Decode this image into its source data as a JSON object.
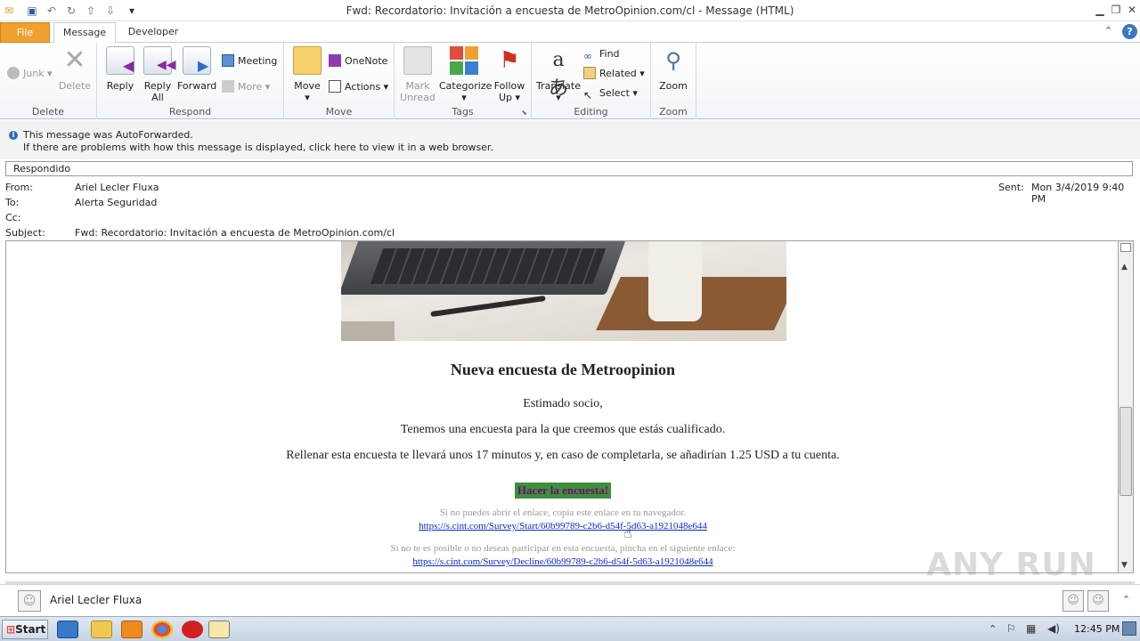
{
  "window": {
    "title": "Fwd: Recordatorio: Invitación a encuesta de MetroOpinion.com/cl - Message (HTML)"
  },
  "tabs": {
    "file": "File",
    "message": "Message",
    "developer": "Developer"
  },
  "ribbon": {
    "delete_group": {
      "label": "Delete",
      "junk": "Junk",
      "delete": "Delete"
    },
    "respond_group": {
      "label": "Respond",
      "reply": "Reply",
      "reply_all_1": "Reply",
      "reply_all_2": "All",
      "forward": "Forward",
      "meeting": "Meeting",
      "more": "More"
    },
    "move_group": {
      "label": "Move",
      "move": "Move",
      "onenote": "OneNote",
      "actions": "Actions"
    },
    "tags_group": {
      "label": "Tags",
      "mark_unread_1": "Mark",
      "mark_unread_2": "Unread",
      "categorize": "Categorize",
      "follow_up_1": "Follow",
      "follow_up_2": "Up"
    },
    "editing_group": {
      "label": "Editing",
      "translate": "Translate",
      "find": "Find",
      "related": "Related",
      "select": "Select"
    },
    "zoom_group": {
      "label": "Zoom",
      "zoom": "Zoom"
    }
  },
  "info_bar": {
    "line1": "This message was AutoForwarded.",
    "line2": "If there are problems with how this message is displayed, click here to view it in a web browser."
  },
  "status_text": "Respondido",
  "header": {
    "from_label": "From:",
    "from": "Ariel Lecler Fluxa",
    "to_label": "To:",
    "to": "Alerta Seguridad",
    "cc_label": "Cc:",
    "cc": "",
    "subject_label": "Subject:",
    "subject": "Fwd: Recordatorio: Invitación a encuesta de MetroOpinion.com/cl",
    "sent_label": "Sent:",
    "sent": "Mon 3/4/2019 9:40 PM"
  },
  "email": {
    "heading": "Nueva encuesta de Metroopinion",
    "greeting": "Estimado socio,",
    "p1": "Tenemos una encuesta para la que creemos que estás cualificado.",
    "p2": "Rellenar esta encuesta te llevará unos 17 minutos y, en caso de completarla, se añadirían 1.25 USD a tu cuenta.",
    "button": "Hacer la encuesta!",
    "copy_note": "Si no puedes abrir el enlace, copia este enlace en tu navegador.",
    "start_link": "https://s.cint.com/Survey/Start/60b99789-c2b6-d54f-5d63-a1921048e644",
    "decline_note": "Si no te es posible o no deseas participar en esta encuesta, pincha en el siguiente enlace:",
    "decline_link": "https://s.cint.com/Survey/Decline/60b99789-c2b6-d54f-5d63-a1921048e644"
  },
  "people_pane": {
    "name": "Ariel Lecler Fluxa"
  },
  "taskbar": {
    "start": "Start",
    "clock": "12:45 PM"
  },
  "watermark": "ANY RUN",
  "colors": {
    "file_tab": "#f0a030",
    "button_bg": "#3d8e3d",
    "button_text": "#6d0f6d",
    "link": "#0b2bd0"
  }
}
